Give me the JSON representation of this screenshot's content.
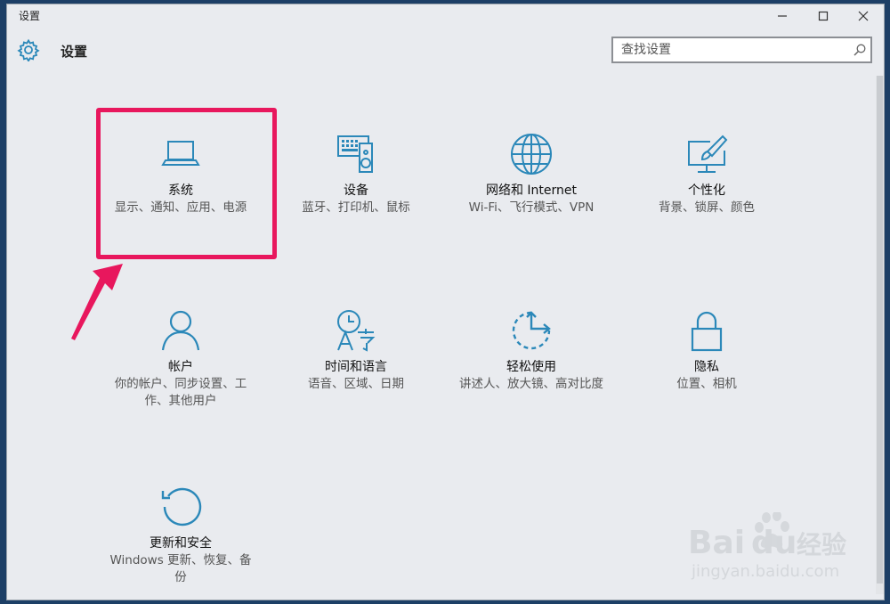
{
  "window": {
    "title": "设置",
    "controls": {
      "minimize": "—",
      "maximize": "☐",
      "close": "✕"
    }
  },
  "header": {
    "title": "设置",
    "icon": "gear-icon",
    "search": {
      "placeholder": "查找设置",
      "value": ""
    }
  },
  "tiles": [
    {
      "id": "system",
      "icon": "laptop-icon",
      "title": "系统",
      "desc": "显示、通知、应用、电源"
    },
    {
      "id": "devices",
      "icon": "keyboard-speaker-icon",
      "title": "设备",
      "desc": "蓝牙、打印机、鼠标"
    },
    {
      "id": "network",
      "icon": "globe-icon",
      "title": "网络和 Internet",
      "desc": "Wi-Fi、飞行模式、VPN"
    },
    {
      "id": "personalization",
      "icon": "paint-monitor-icon",
      "title": "个性化",
      "desc": "背景、锁屏、颜色"
    },
    {
      "id": "accounts",
      "icon": "person-icon",
      "title": "帐户",
      "desc": "你的帐户、同步设置、工作、其他用户"
    },
    {
      "id": "time-language",
      "icon": "clock-language-icon",
      "title": "时间和语言",
      "desc": "语音、区域、日期"
    },
    {
      "id": "ease-of-access",
      "icon": "ease-of-access-icon",
      "title": "轻松使用",
      "desc": "讲述人、放大镜、高对比度"
    },
    {
      "id": "privacy",
      "icon": "lock-icon",
      "title": "隐私",
      "desc": "位置、相机"
    },
    {
      "id": "update-security",
      "icon": "refresh-icon",
      "title": "更新和安全",
      "desc": "Windows 更新、恢复、备份"
    }
  ],
  "annotation": {
    "highlight_color": "#e8175d",
    "target": "系统"
  },
  "watermark": {
    "brand": "Bai",
    "brand2": "du",
    "cn": "经验",
    "url": "jingyan.baidu.com"
  },
  "colors": {
    "accent": "#2b88b9",
    "background": "#e9ebef"
  }
}
